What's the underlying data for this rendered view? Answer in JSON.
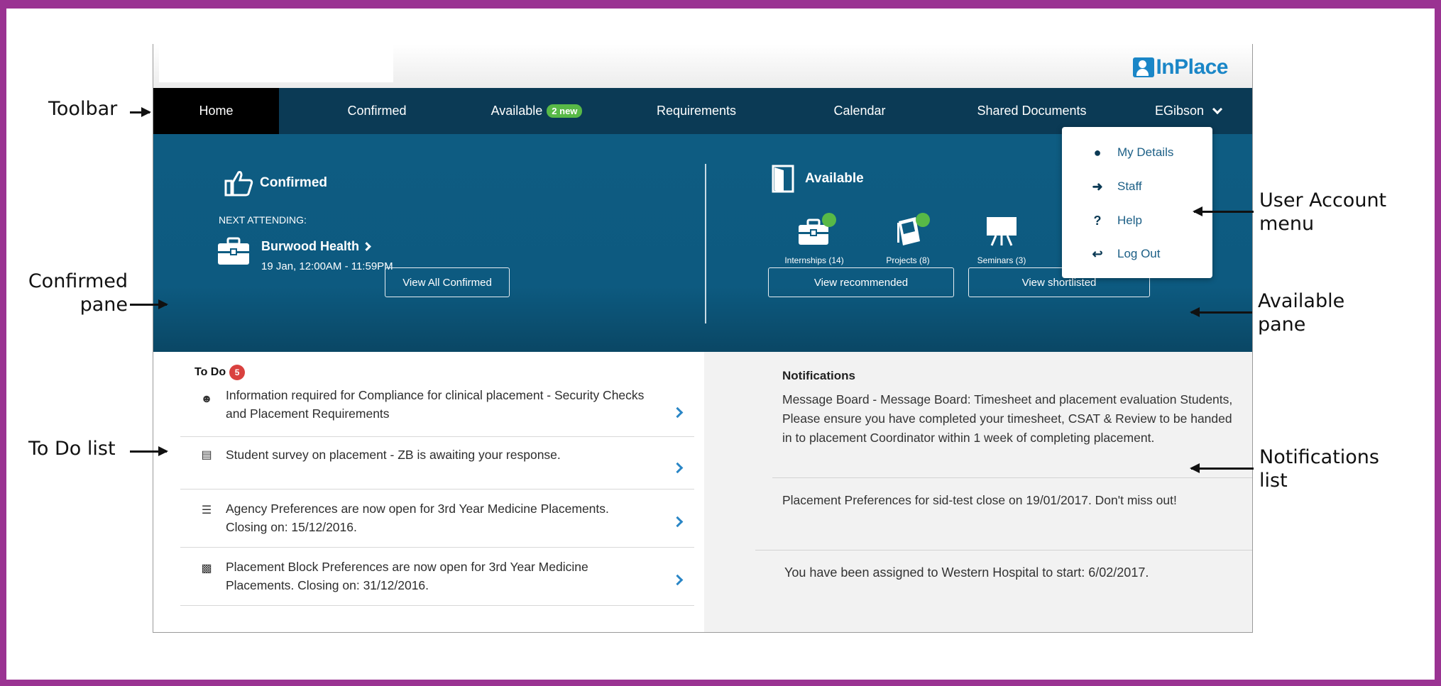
{
  "header": {
    "logo_text": "InPlace"
  },
  "toolbar": {
    "home": "Home",
    "confirmed": "Confirmed",
    "available": "Available",
    "available_badge": "2 new",
    "requirements": "Requirements",
    "calendar": "Calendar",
    "shared_documents": "Shared Documents",
    "user": "EGibson"
  },
  "confirmed_pane": {
    "title": "Confirmed",
    "next_attending_label": "NEXT ATTENDING:",
    "placement_name": "Burwood Health",
    "placement_time": "19 Jan, 12:00AM - 11:59PM",
    "view_all_button": "View All Confirmed"
  },
  "available_pane": {
    "title": "Available",
    "categories": [
      {
        "label": "Internships (14)",
        "icon": "briefcase-icon",
        "new": true
      },
      {
        "label": "Projects (8)",
        "icon": "notebook-icon",
        "new": true
      },
      {
        "label": "Seminars (3)",
        "icon": "easel-icon",
        "new": false
      }
    ],
    "view_recommended_button": "View recommended",
    "view_shortlisted_button": "View shortlisted"
  },
  "user_menu": {
    "items": [
      "My Details",
      "Staff",
      "Help",
      "Log Out"
    ]
  },
  "todo": {
    "title": "To Do",
    "count": "5",
    "items": [
      {
        "icon": "user-alert-icon",
        "text": "Information required for Compliance for clinical placement - Security Checks and Placement Requirements"
      },
      {
        "icon": "survey-icon",
        "text": "Student survey on placement - ZB is awaiting your response."
      },
      {
        "icon": "list-icon",
        "text": "Agency Preferences are now open for 3rd Year Medicine Placements. Closing on: 15/12/2016."
      },
      {
        "icon": "calendar-edit-icon",
        "text": "Placement Block Preferences are now open for 3rd Year Medicine Placements. Closing on: 31/12/2016."
      }
    ]
  },
  "notifications": {
    "title": "Notifications",
    "items": [
      "Message Board - Message Board: Timesheet and placement evaluation Students,  Please ensure you have completed your timesheet, CSAT & Review to be handed in to placement Coordinator within 1 week of completing placement.",
      "Placement Preferences for sid-test close on 19/01/2017. Don't miss out!",
      "You have been assigned to Western Hospital to start: 6/02/2017."
    ]
  },
  "annotations": {
    "toolbar": "Toolbar",
    "confirmed_pane": "Confirmed pane",
    "todo_list": "To Do list",
    "user_account_menu": "User Account menu",
    "available_pane": "Available pane",
    "notifications_list": "Notifications list"
  },
  "colors": {
    "frame": "#9a3392",
    "toolbar": "#0b3a55",
    "hero": "#0e5c82",
    "badge_green": "#58b947",
    "todo_badge": "#d9413f",
    "chevron_blue": "#2a86c6"
  }
}
